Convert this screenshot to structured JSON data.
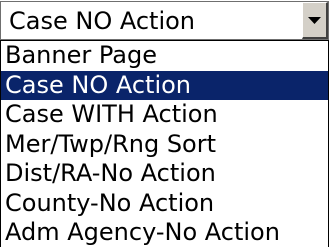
{
  "select": {
    "value": "Case NO Action",
    "arrow_icon": "chevron-down-icon"
  },
  "options": [
    {
      "label": "Banner Page",
      "selected": false
    },
    {
      "label": "Case NO Action",
      "selected": true
    },
    {
      "label": "Case WITH Action",
      "selected": false
    },
    {
      "label": "Mer/Twp/Rng Sort",
      "selected": false
    },
    {
      "label": "Dist/RA-No Action",
      "selected": false
    },
    {
      "label": "County-No Action",
      "selected": false
    },
    {
      "label": "Adm Agency-No Action",
      "selected": false
    }
  ],
  "colors": {
    "highlight_bg": "#0a246a",
    "highlight_text": "#ffffff",
    "button_face": "#d4d0c8"
  }
}
